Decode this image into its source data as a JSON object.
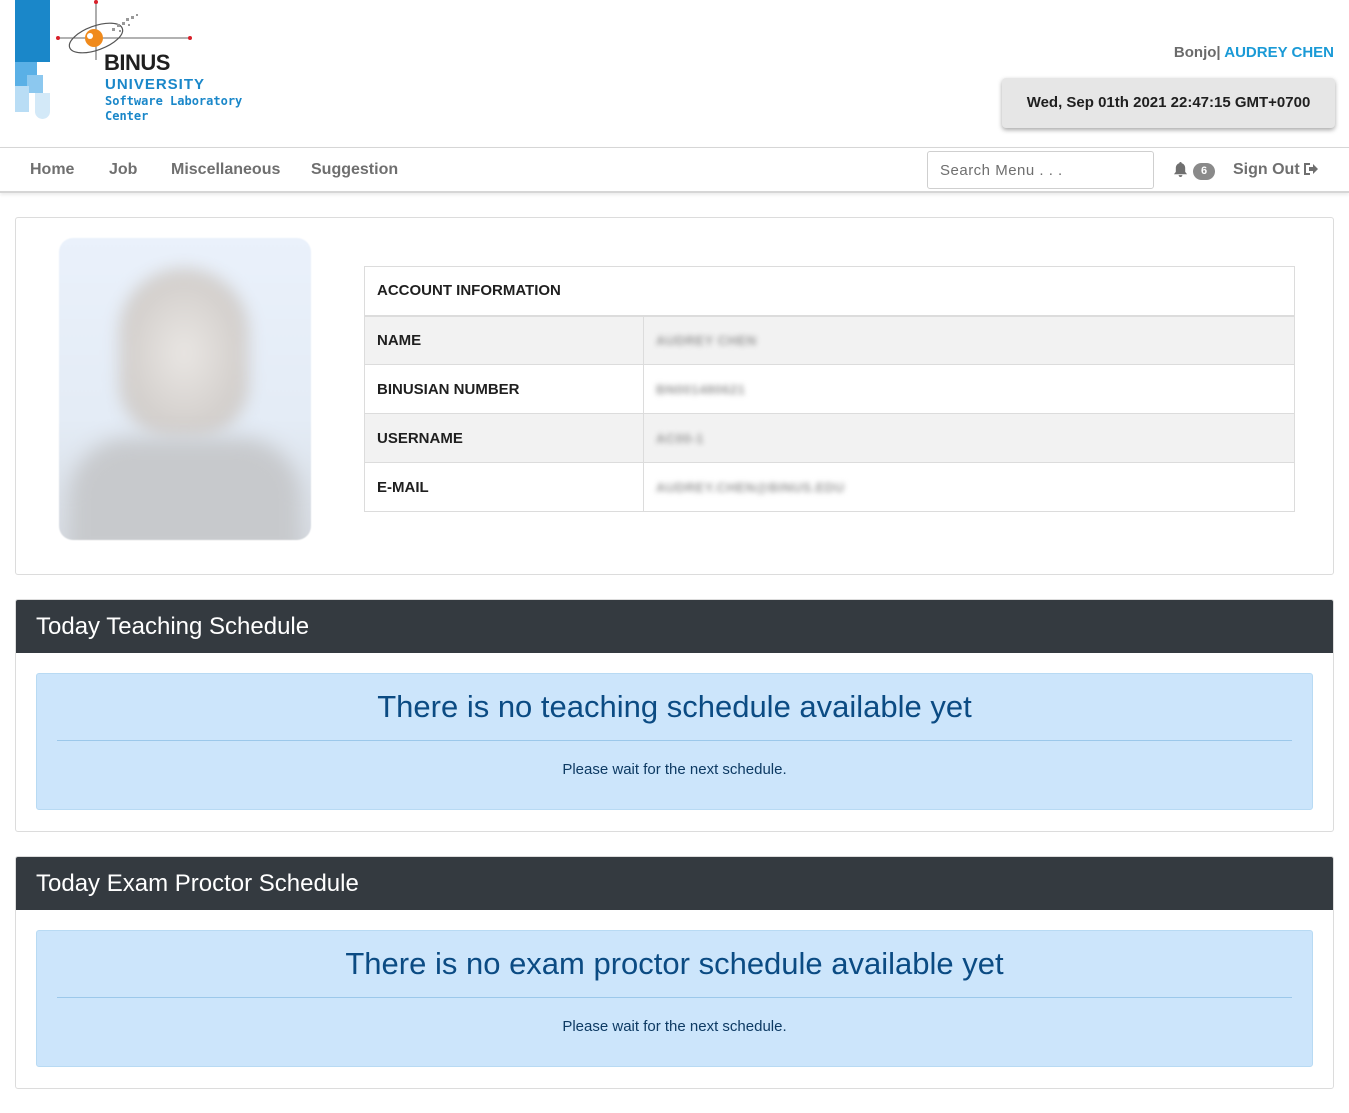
{
  "brand": {
    "name": "BINUS",
    "university": "UNIVERSITY",
    "dept_line1": "Software Laboratory",
    "dept_line2": "Center"
  },
  "user": {
    "nickname": "Bonjo",
    "separator": "|",
    "full_name": "AUDREY CHEN"
  },
  "datetime": "Wed, Sep 01th 2021 22:47:15 GMT+0700",
  "nav": {
    "items": [
      "Home",
      "Job",
      "Miscellaneous",
      "Suggestion"
    ],
    "search_placeholder": "Search Menu . . .",
    "notification_count": "6",
    "sign_out": "Sign Out"
  },
  "account": {
    "header": "ACCOUNT INFORMATION",
    "rows": [
      {
        "label": "NAME",
        "value": "AUDREY CHEN"
      },
      {
        "label": "BINUSIAN NUMBER",
        "value": "BN001480621"
      },
      {
        "label": "USERNAME",
        "value": "AC00-1"
      },
      {
        "label": "E-MAIL",
        "value": "AUDREY.CHEN@BINUS.EDU"
      }
    ]
  },
  "teaching": {
    "title": "Today Teaching Schedule",
    "message": "There is no teaching schedule available yet",
    "sub": "Please wait for the next schedule."
  },
  "proctor": {
    "title": "Today Exam Proctor Schedule",
    "message": "There is no exam proctor schedule available yet",
    "sub": "Please wait for the next schedule."
  },
  "colors": {
    "accent": "#1a9ad6",
    "panel_header": "#343a40",
    "alert_bg": "#cce5fb"
  }
}
